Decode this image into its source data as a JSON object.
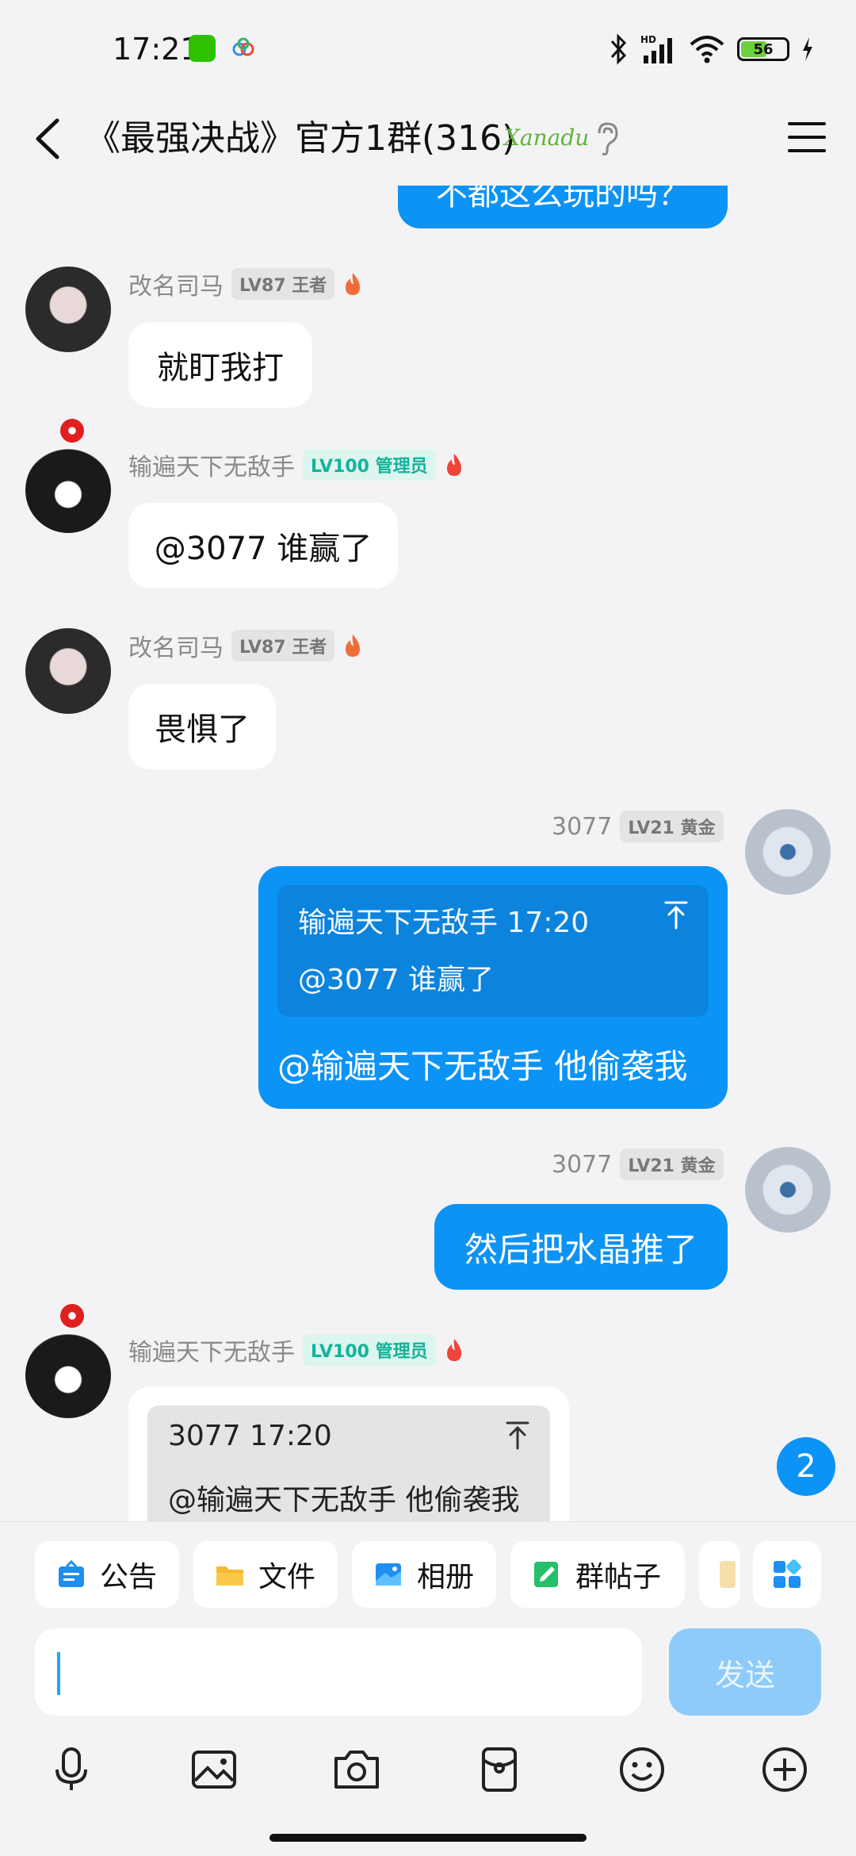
{
  "status_bar": {
    "time": "17:21",
    "battery": "56"
  },
  "header": {
    "title": "《最强决战》官方1群(316)",
    "badge_text": "Xanadu"
  },
  "messages": [
    {
      "text": "不都这么玩的吗？"
    },
    {
      "sender": "改名司马",
      "level": "LV87 王者",
      "text": "就盯我打"
    },
    {
      "sender": "输遍天下无敌手",
      "level": "LV100 管理员",
      "text": "@3077 谁赢了"
    },
    {
      "sender": "改名司马",
      "level": "LV87 王者",
      "text": "畏惧了"
    },
    {
      "sender": "3077",
      "level": "LV21 黄金",
      "quote_head": "输遍天下无敌手 17:20",
      "quote_body": "@3077 谁赢了",
      "text": "@输遍天下无敌手 他偷袭我"
    },
    {
      "sender": "3077",
      "level": "LV21 黄金",
      "text": "然后把水晶推了"
    },
    {
      "sender": "输遍天下无敌手",
      "level": "LV100 管理员",
      "quote_head": "3077 17:20",
      "quote_body": "@输遍天下无敌手 他偷袭我"
    }
  ],
  "unread_count": "2",
  "shortcuts": [
    "公告",
    "文件",
    "相册",
    "群帖子"
  ],
  "input": {
    "value": "",
    "send_label": "发送"
  },
  "colors": {
    "accent": "#0b93f6",
    "admin_badge": "#14b39a"
  }
}
